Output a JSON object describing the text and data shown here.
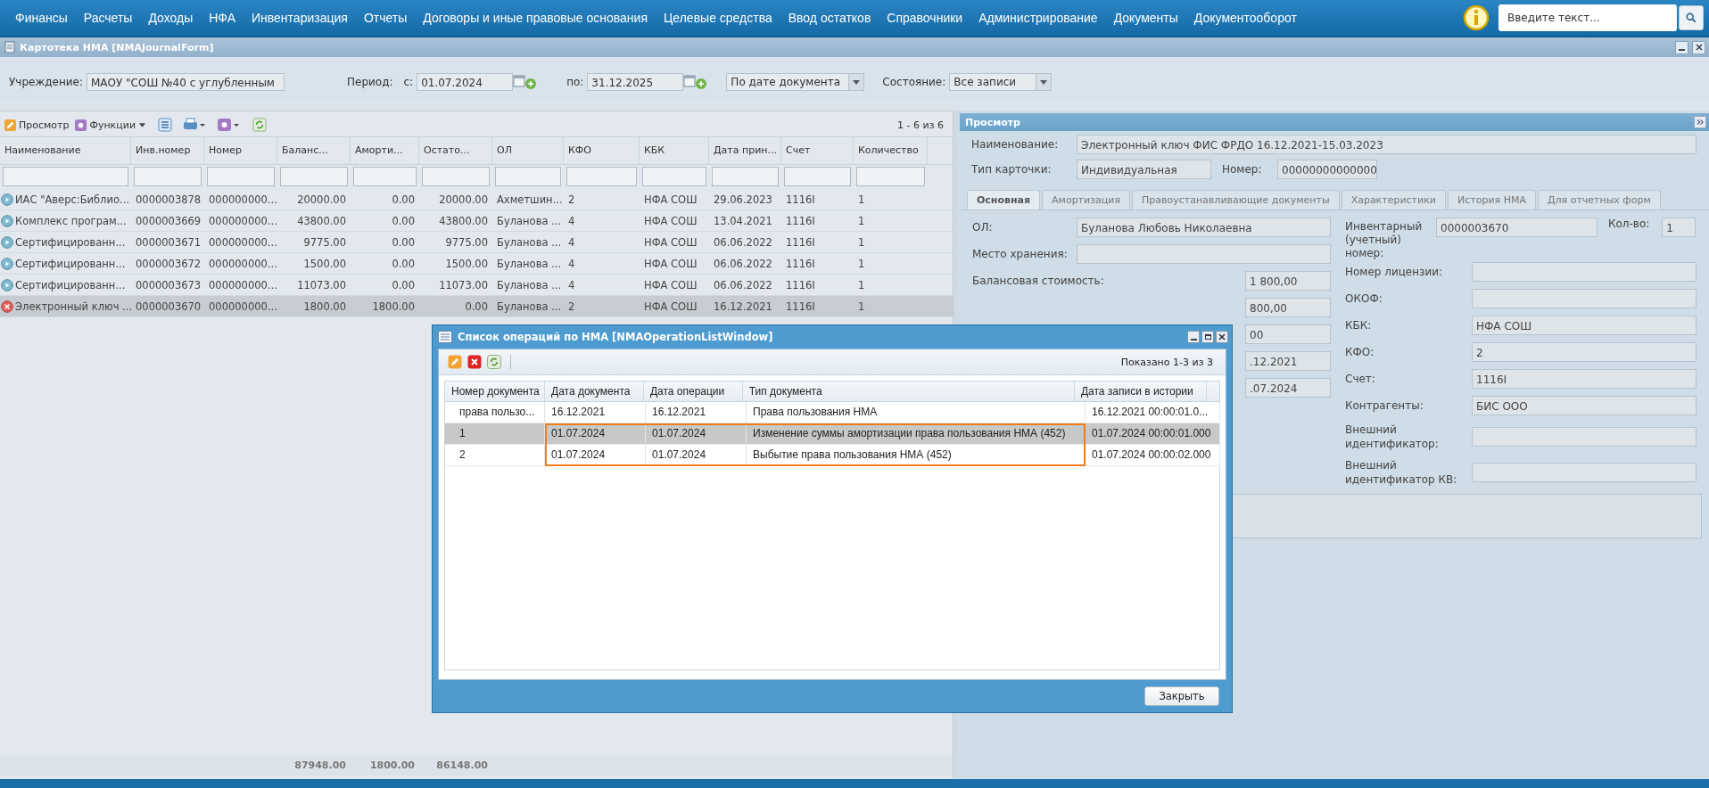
{
  "nav": {
    "items": [
      "Финансы",
      "Расчеты",
      "Доходы",
      "НФА",
      "Инвентаризация",
      "Отчеты",
      "Договоры и иные правовые основания",
      "Целевые средства",
      "Ввод остатков",
      "Справочники",
      "Администрирование",
      "Документы",
      "Документооборот"
    ],
    "search": {
      "placeholder": "Введите текст..."
    }
  },
  "window": {
    "title": "Картотека НМА [NMAJournalForm]"
  },
  "filters": {
    "institution_label": "Учреждение:",
    "institution": "МАОУ  \"СОШ №40 с углубленным",
    "period_label": "Период:",
    "from_label": "с:",
    "from": "01.07.2024",
    "to_label": "по:",
    "to": "31.12.2025",
    "date_mode": "По дате документа",
    "state_label": "Состояние:",
    "state": "Все записи"
  },
  "toolbar": {
    "view": "Просмотр",
    "functions": "Функции",
    "paging": "1 - 6 из 6"
  },
  "table": {
    "columns": [
      "Наименование",
      "Инв.номер",
      "Номер",
      "Баланс...",
      "Аморти...",
      "Остато...",
      "ОЛ",
      "КФО",
      "КБК",
      "Дата прин...",
      "Счет",
      "Количество"
    ],
    "rows": [
      {
        "kind": "active",
        "selected": false,
        "cells": [
          "ИАС \"Аверс:Библио...",
          "0000003878",
          "000000000...",
          "20000.00",
          "0.00",
          "20000.00",
          "Ахметшин...",
          "2",
          "НФА СОШ",
          "29.06.2023",
          "1116I",
          "1"
        ]
      },
      {
        "kind": "active",
        "selected": false,
        "cells": [
          "Комплекс програм...",
          "0000003669",
          "000000000...",
          "43800.00",
          "0.00",
          "43800.00",
          "Буланова ...",
          "4",
          "НФА СОШ",
          "13.04.2021",
          "1116I",
          "1"
        ]
      },
      {
        "kind": "active",
        "selected": false,
        "cells": [
          "Сертифицированн...",
          "0000003671",
          "000000000...",
          "9775.00",
          "0.00",
          "9775.00",
          "Буланова ...",
          "4",
          "НФА СОШ",
          "06.06.2022",
          "1116I",
          "1"
        ]
      },
      {
        "kind": "active",
        "selected": false,
        "cells": [
          "Сертифицированн...",
          "0000003672",
          "000000000...",
          "1500.00",
          "0.00",
          "1500.00",
          "Буланова ...",
          "4",
          "НФА СОШ",
          "06.06.2022",
          "1116I",
          "1"
        ]
      },
      {
        "kind": "active",
        "selected": false,
        "cells": [
          "Сертифицированн...",
          "0000003673",
          "000000000...",
          "11073.00",
          "0.00",
          "11073.00",
          "Буланова ...",
          "4",
          "НФА СОШ",
          "06.06.2022",
          "1116I",
          "1"
        ]
      },
      {
        "kind": "deleted",
        "selected": true,
        "cells": [
          "Электронный ключ ...",
          "0000003670",
          "000000000...",
          "1800.00",
          "1800.00",
          "0.00",
          "Буланова ...",
          "2",
          "НФА СОШ",
          "16.12.2021",
          "1116I",
          "1"
        ]
      }
    ],
    "totals": [
      "87948.00",
      "1800.00",
      "86148.00"
    ]
  },
  "view_panel": {
    "title": "Просмотр",
    "name_label": "Наименование:",
    "name": "Электронный ключ ФИС ФРДО 16.12.2021-15.03.2023",
    "card_type_label": "Тип карточки:",
    "card_type": "Индивидуальная",
    "number_label": "Номер:",
    "number": "00000000000000",
    "tabs": [
      {
        "label": "Основная",
        "selected": true
      },
      {
        "label": "Амортизация",
        "selected": false
      },
      {
        "label": "Правоустанавливающие документы",
        "selected": false
      },
      {
        "label": "Характеристики",
        "selected": false
      },
      {
        "label": "История НМА",
        "selected": false
      },
      {
        "label": "Для отчетных форм",
        "selected": false
      }
    ],
    "left_fields": [
      {
        "label": "ОЛ:",
        "value": "Буланова Любовь Николаевна"
      },
      {
        "label": "Место хранения:"
      },
      {
        "label": "Балансовая стоимость:",
        "value": "1 800,00"
      },
      {
        "value": "800,00"
      },
      {
        "value": "00"
      },
      {
        "value": ".12.2021"
      },
      {
        "value": ".07.2024"
      }
    ],
    "inventory": {
      "label": "Инвентарный (учетный) номер:",
      "value": "0000003670",
      "qty_label": "Кол-во:",
      "qty": "1"
    },
    "right_fields": [
      {
        "label": "Номер лицензии:"
      },
      {
        "label": "ОКОФ:"
      },
      {
        "label": "КБК:",
        "value": "НФА СОШ"
      },
      {
        "label": "КФО:",
        "value": "2"
      },
      {
        "label": "Счет:",
        "value": "1116I"
      },
      {
        "label": "Контрагенты:",
        "value": "БИС ООО"
      },
      {
        "label": "Внешний идентификатор:"
      },
      {
        "label": "Внешний идентификатор КВ:"
      }
    ]
  },
  "dialog": {
    "title": "Список операций по НМА [NMAOperationListWindow]",
    "shown": "Показано 1-3 из 3",
    "columns": [
      "Номер документа",
      "Дата документа",
      "Дата операции",
      "Тип документа",
      "Дата записи в истории"
    ],
    "rows": [
      {
        "selected": false,
        "highlighted": false,
        "cells": [
          "права пользо...",
          "16.12.2021",
          "16.12.2021",
          "Права пользования НМА",
          "16.12.2021 00:00:01.0..."
        ]
      },
      {
        "selected": true,
        "highlighted": true,
        "cells": [
          "1",
          "01.07.2024",
          "01.07.2024",
          "Изменение суммы амортизации права пользования НМА (452)",
          "01.07.2024 00:00:01.000"
        ]
      },
      {
        "selected": false,
        "highlighted": true,
        "cells": [
          "2",
          "01.07.2024",
          "01.07.2024",
          "Выбытие права пользования НМА (452)",
          "01.07.2024 00:00:02.000"
        ]
      }
    ],
    "close": "Закрыть"
  }
}
